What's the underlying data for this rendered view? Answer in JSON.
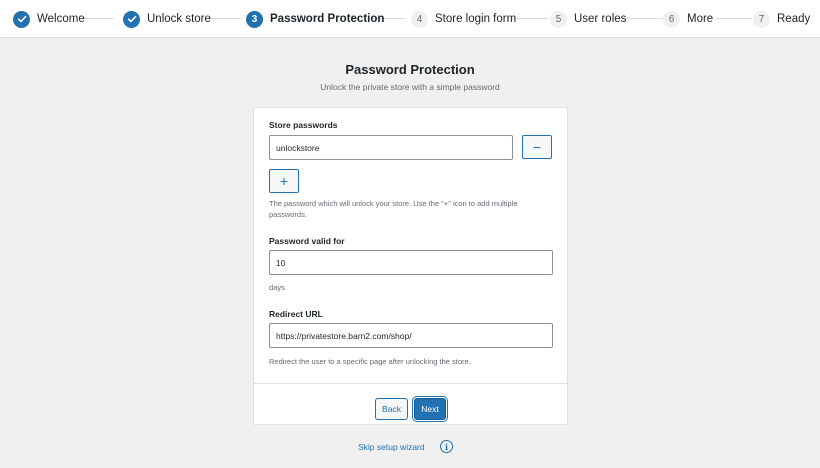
{
  "steps": [
    {
      "number": "1",
      "label": "Welcome",
      "state": "done"
    },
    {
      "number": "2",
      "label": "Unlock store",
      "state": "done"
    },
    {
      "number": "3",
      "label": "Password Protection",
      "state": "active"
    },
    {
      "number": "4",
      "label": "Store login form",
      "state": "todo"
    },
    {
      "number": "5",
      "label": "User roles",
      "state": "todo"
    },
    {
      "number": "6",
      "label": "More",
      "state": "todo"
    },
    {
      "number": "7",
      "label": "Ready",
      "state": "todo"
    }
  ],
  "header": {
    "title": "Password Protection",
    "subtitle": "Unlock the private store with a simple password"
  },
  "form": {
    "passwords": {
      "label": "Store passwords",
      "value": "unlockstore",
      "remove_icon": "minus-icon",
      "add_icon": "plus-icon",
      "remove_label": "−",
      "add_label": "+",
      "help": "The password which will unlock your store. Use the \"+\" icon to add multiple passwords."
    },
    "valid_for": {
      "label": "Password valid for",
      "value": "10",
      "help": "days"
    },
    "redirect": {
      "label": "Redirect URL",
      "value": "https://privatestore.barn2.com/shop/",
      "help": "Redirect the user to a specific page after unlocking the store."
    }
  },
  "footer": {
    "back_label": "Back",
    "next_label": "Next"
  },
  "skip": {
    "label": "Skip setup wizard",
    "info_icon": "info-icon",
    "info_glyph": "i"
  },
  "colors": {
    "accent": "#2271b1",
    "background": "#f0f0f1",
    "muted_text": "#646970"
  }
}
